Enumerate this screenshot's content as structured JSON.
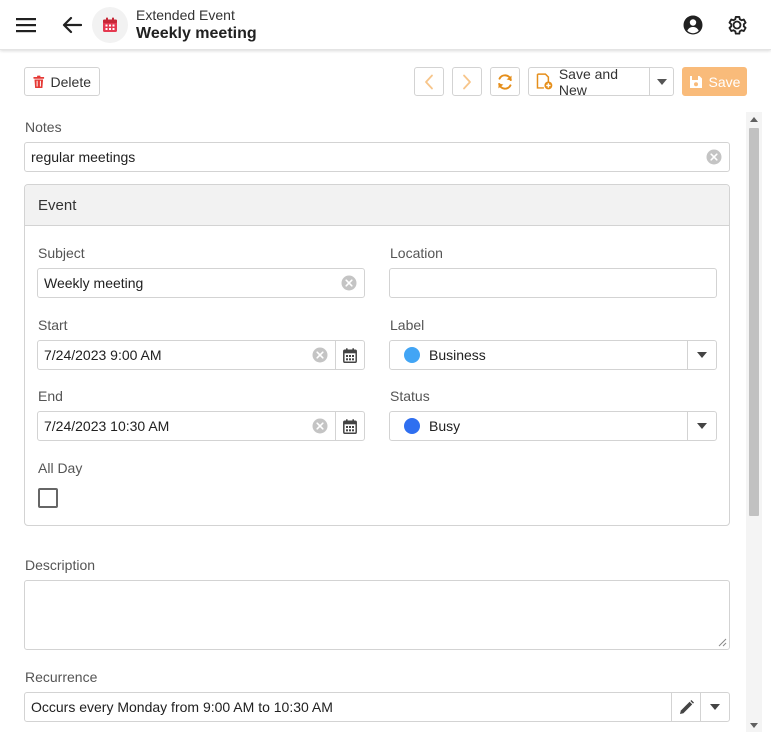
{
  "header": {
    "subtitle": "Extended Event",
    "title": "Weekly meeting",
    "icons": {
      "menu": "hamburger-icon",
      "back": "arrow-left-icon",
      "app": "calendar-icon",
      "user": "user-circle-icon",
      "settings": "gear-icon"
    }
  },
  "toolbar": {
    "delete_label": "Delete",
    "save_new_label": "Save and New",
    "save_label": "Save"
  },
  "notes": {
    "label": "Notes",
    "value": "regular meetings"
  },
  "event_group": {
    "title": "Event",
    "subject": {
      "label": "Subject",
      "value": "Weekly meeting"
    },
    "location": {
      "label": "Location",
      "value": ""
    },
    "start": {
      "label": "Start",
      "value": "7/24/2023 9:00 AM"
    },
    "end": {
      "label": "End",
      "value": "7/24/2023 10:30 AM"
    },
    "label_field": {
      "label": "Label",
      "value": "Business",
      "color": "#42a5f5"
    },
    "status": {
      "label": "Status",
      "value": "Busy",
      "color": "#2f6ff0"
    },
    "all_day": {
      "label": "All Day",
      "checked": false
    }
  },
  "description": {
    "label": "Description",
    "value": ""
  },
  "recurrence": {
    "label": "Recurrence",
    "value": "Occurs every Monday from 9:00 AM to 10:30 AM"
  },
  "colors": {
    "accent": "#f9bb7a",
    "delete_red": "#e53935",
    "nav_orange": "#f7c58a",
    "refresh_orange": "#e58e1a"
  }
}
